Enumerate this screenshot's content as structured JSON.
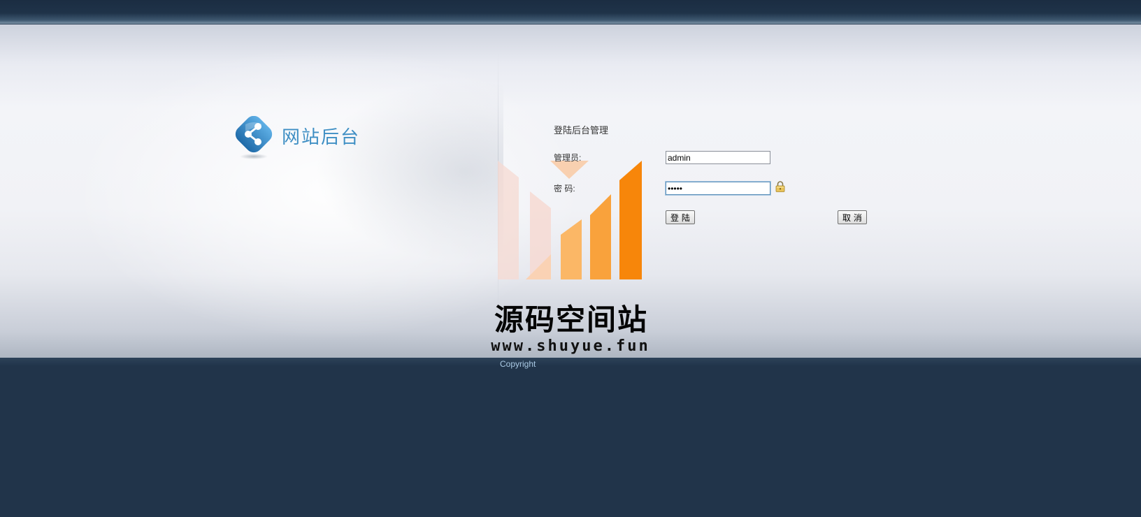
{
  "header": {
    "logo_text": "网站后台"
  },
  "login_form": {
    "title": "登陆后台管理",
    "username_label": "管理员:",
    "username_value": "admin",
    "password_label": "密 码:",
    "password_value": "*****",
    "login_button": "登 陆",
    "cancel_button": "取 消"
  },
  "watermark": {
    "title": "源码空间站",
    "url": "www.shuyue.fun"
  },
  "footer": {
    "copyright": "Copyright"
  },
  "colors": {
    "page_background": "#21344a",
    "logo_text": "#3f8fc4",
    "logo_icon": "#2f7fc0",
    "watermark_orange": "#f7860a",
    "copyright_text": "#a9c9e4"
  },
  "icons": [
    "share-logo-icon",
    "lock-icon"
  ]
}
